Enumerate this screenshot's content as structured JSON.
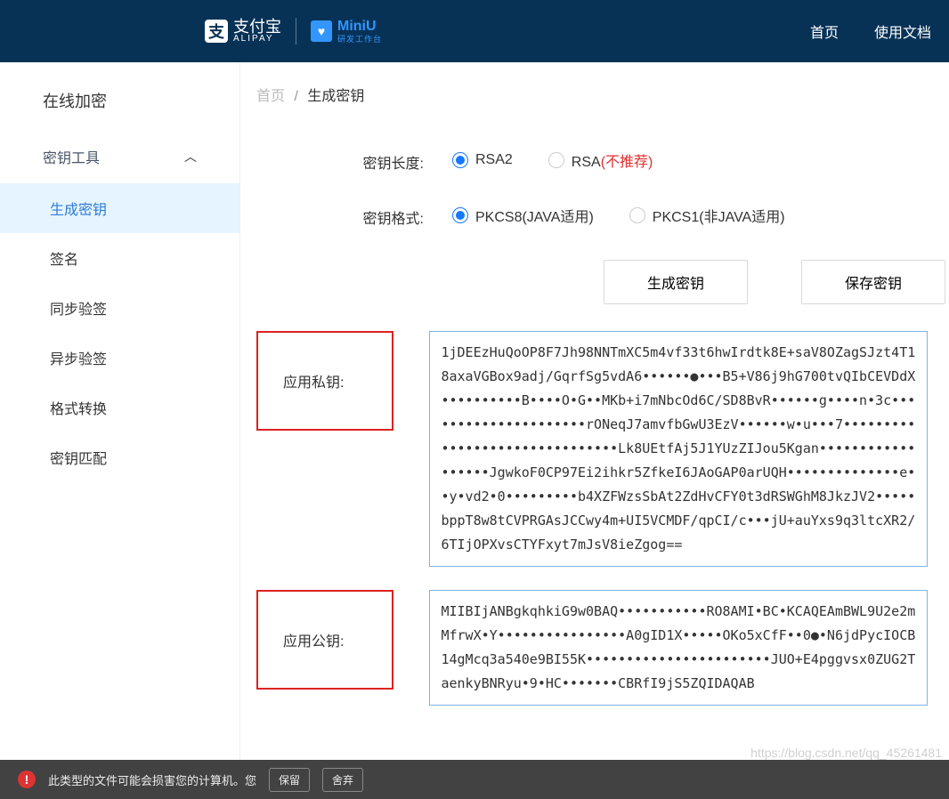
{
  "header": {
    "alipay_cn": "支付宝",
    "alipay_en": "ALIPAY",
    "alipay_icon_glyph": "支",
    "miniu_name": "MiniU",
    "miniu_sub": "研发工作台",
    "miniu_icon_glyph": "♥",
    "nav": {
      "home": "首页",
      "docs": "使用文档"
    }
  },
  "sidebar": {
    "title": "在线加密",
    "group_label": "密钥工具",
    "items": [
      "生成密钥",
      "签名",
      "同步验签",
      "异步验签",
      "格式转换",
      "密钥匹配"
    ],
    "active_index": 0
  },
  "breadcrumb": {
    "home": "首页",
    "current": "生成密钥"
  },
  "form": {
    "length_label": "密钥长度:",
    "length_options": {
      "rsa2": "RSA2",
      "rsa": "RSA",
      "not_rec": "(不推荐)"
    },
    "format_label": "密钥格式:",
    "format_options": {
      "pkcs8": "PKCS8(JAVA适用)",
      "pkcs1": "PKCS1(非JAVA适用)"
    }
  },
  "buttons": {
    "generate": "生成密钥",
    "save": "保存密钥"
  },
  "keys": {
    "private_label": "应用私钥:",
    "private_value": "1jDEEzHuQoOP8F7Jh98NNTmXC5m4vf33t6hwIrdtk8E+saV8OZagSJzt4T18axaVGBox9adj/GqrfSg5vdA6••••••●•••B5+V86j9hG700tvQIbCEVDdX••••••••••B••••O•G••MKb+i7mNbcOd6C/SD8BvR••••••g••••n•3c•••••••••••••••••••••rONeqJ7amvfbGwU3EzV••••••w•u•••7•••••••••••••••••••••••••••••••Lk8UEtfAj5J1YUzZIJou5Kgan••••••••••••••••••JgwkoF0CP97Ei2ihkr5ZfkeI6JAoGAP0arUQH••••••••••••••e••y•vd2•0•••••••••b4XZFWzsSbAt2ZdHvCFY0t3dRSWGhM8JkzJV2•••••bppT8w8tCVPRGAsJCCwy4m+UI5VCMDF/qpCI/c•••jU+auYxs9q3ltcXR2/6TIjOPXvsCTYFxyt7mJsV8ieZgog==",
    "public_label": "应用公钥:",
    "public_value": "MIIBIjANBgkqhkiG9w0BAQ•••••••••••RO8AMI•BC•KCAQEAmBWL9U2e2mMfrwX•Y••••••••••••••••A0gID1X•••••OKo5xCfF••0●•N6jdPycIOCB14gMcq3a540e9BI55K•••••••••••••••••••••••JUO+E4pggvsx0ZUG2TaenkyBNRyu•9•HC•••••••CBRfI9jS5ZQIDAQAB"
  },
  "footer": {
    "warn": "此类型的文件可能会损害您的计算机。您",
    "btn1": "保留",
    "btn2": "舍弃"
  },
  "watermark": "https://blog.csdn.net/qq_45261481"
}
